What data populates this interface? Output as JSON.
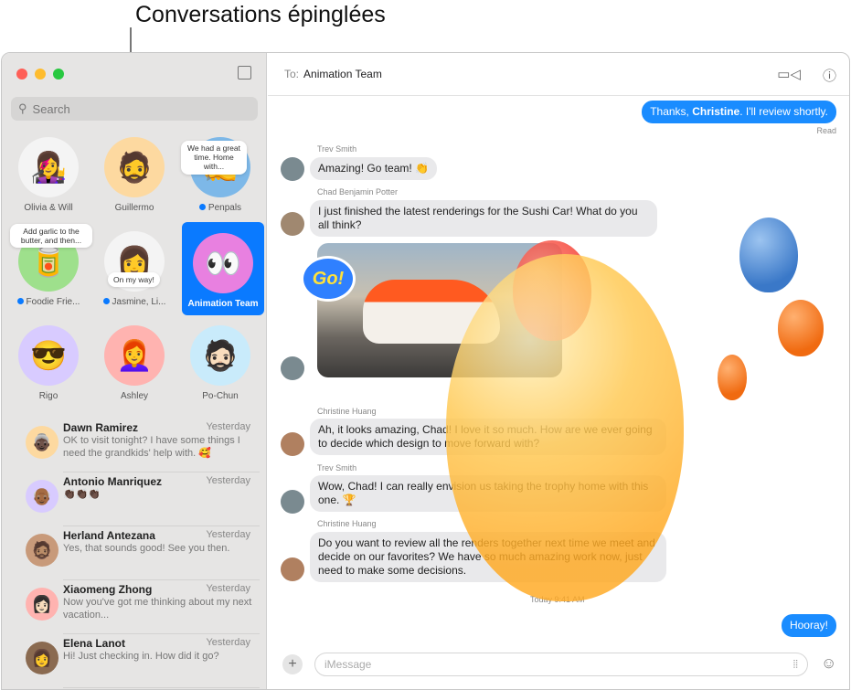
{
  "caption": "Conversations épinglées",
  "sidebar": {
    "search_placeholder": "Search",
    "pinned": [
      {
        "label": "Olivia & Will",
        "unread": false
      },
      {
        "label": "Guillermo",
        "unread": false
      },
      {
        "label": "Penpals",
        "unread": true,
        "tip": "We had a great time. Home with..."
      },
      {
        "label": "Foodie Frie...",
        "unread": true,
        "tip": "Add garlic to the butter, and then..."
      },
      {
        "label": "Jasmine, Li...",
        "unread": true,
        "tip": "On my way!"
      },
      {
        "label": "Animation Team",
        "unread": false,
        "selected": true
      },
      {
        "label": "Rigo"
      },
      {
        "label": "Ashley"
      },
      {
        "label": "Po-Chun"
      }
    ],
    "conversations": [
      {
        "name": "Dawn Ramirez",
        "time": "Yesterday",
        "preview": "OK to visit tonight? I have some things I need the grandkids' help with. 🥰"
      },
      {
        "name": "Antonio Manriquez",
        "time": "Yesterday",
        "preview": "👏🏿👏🏿👏🏿"
      },
      {
        "name": "Herland Antezana",
        "time": "Yesterday",
        "preview": "Yes, that sounds good! See you then."
      },
      {
        "name": "Xiaomeng Zhong",
        "time": "Yesterday",
        "preview": "Now you've got me thinking about my next vacation..."
      },
      {
        "name": "Elena Lanot",
        "time": "Yesterday",
        "preview": "Hi! Just checking in. How did it go?"
      }
    ]
  },
  "header": {
    "to_label": "To:",
    "recipient": "Animation Team"
  },
  "messages": {
    "out1_pre": "Thanks, ",
    "out1_bold": "Christine",
    "out1_post": ". I'll review shortly.",
    "read": "Read",
    "m1_sender": "Trev Smith",
    "m1": "Amazing! Go team! 👏",
    "m2_sender": "Chad Benjamin Potter",
    "m2": "I just finished the latest renderings for the Sushi Car! What do you all think?",
    "m3_sender": "Christine Huang",
    "m3": "Ah, it looks amazing, Chad! I love it so much. How are we ever going to decide which design to move forward with?",
    "m4_sender": "Trev Smith",
    "m4": "Wow, Chad! I can really envision us taking the trophy home with this one. 🏆",
    "m5_sender": "Christine Huang",
    "m5": "Do you want to review all the renders together next time we meet and decide on our favorites? We have so much amazing work now, just need to make some decisions.",
    "timestamp": "Today 9:41 AM",
    "out2": "Hooray!",
    "sticker": "Go!"
  },
  "composer": {
    "placeholder": "iMessage"
  },
  "colors": {
    "accent": "#0a7aff",
    "bubble_out": "#1a8cff",
    "bubble_in": "#e9e9eb"
  }
}
